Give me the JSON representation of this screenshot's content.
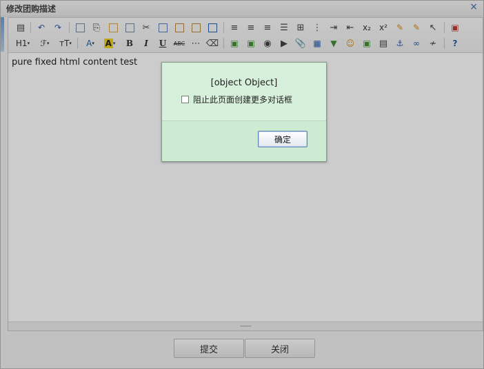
{
  "window": {
    "title": "修改团购描述",
    "close_glyph": "×"
  },
  "toolbar": {
    "heading_label": "H1",
    "font_family_label": "ℱ",
    "font_size_label": "тT",
    "font_color_label": "A",
    "highlight_label": "A",
    "bold_label": "B",
    "italic_label": "I",
    "underline_label": "U",
    "strike_label": "ABC",
    "subscript_label": "x₂",
    "superscript_label": "x²"
  },
  "editor": {
    "content": "pure fixed html content test"
  },
  "footer": {
    "submit_label": "提交",
    "close_label": "关闭"
  },
  "alert": {
    "message": "[object Object]",
    "checkbox_label": "阻止此页面创建更多对话框",
    "ok_label": "确定"
  }
}
